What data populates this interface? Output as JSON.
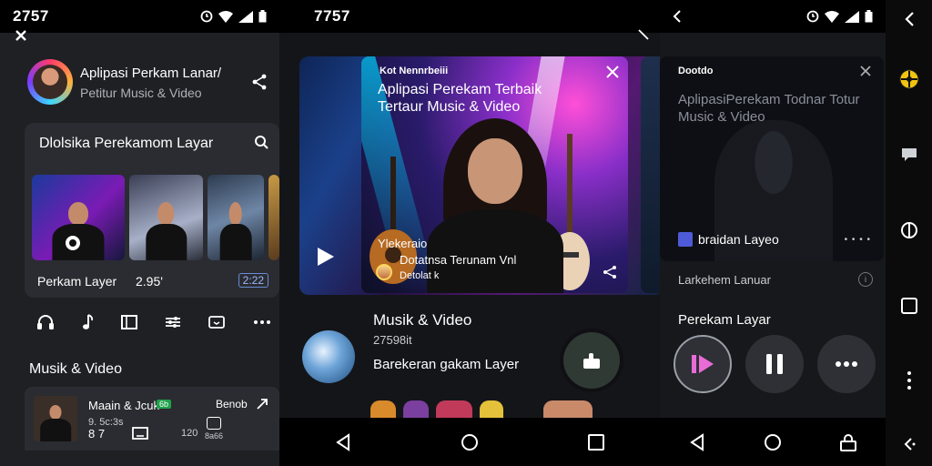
{
  "panel1": {
    "status_time": "2757",
    "header_title": "Aplipasi Perkam Lanar/",
    "header_subtitle": "Petitur Music & Video",
    "card_title": "Dlolsika Perekamom Layar",
    "card_footer_label": "Perkam Layer",
    "card_footer_count": "2.95'",
    "card_footer_badge": "2:22",
    "section_title": "Musik & Video",
    "row_title": "Maain & Jcuk",
    "row_badge": "6b",
    "row_meta_1": "9. 5c:3s",
    "row_meta_2": "8 7",
    "row_meta_3": "120",
    "row_side": "Benob",
    "row_side_small": "8a66"
  },
  "panel2": {
    "status_time": "7757",
    "card_top_label": "Kot Nennrbeiii",
    "card_title": "Aplipasi Perekam Terbaik Tertaur Music & Video",
    "card_line_1": "Ylekeraio",
    "card_line_2": "Dotatnsa Terunam Vnl",
    "card_line_3": "Detolat k",
    "section_title": "Musik & Video",
    "meta_1": "27598it",
    "meta_2": "Barekeran gakam Layer"
  },
  "panel3": {
    "card_top_label": "Dootdo",
    "card_title": "AplipasiPerekam Todnar Totur Music & Video",
    "flag_label": "braidan Layeo",
    "row_label": "Larkehem Lanuar",
    "section_title": "Perekam Layar"
  },
  "colors": {
    "accent_blue": "#4e5bd8",
    "badge_green": "#1fa24b",
    "play_pink": "#e96bd6"
  }
}
